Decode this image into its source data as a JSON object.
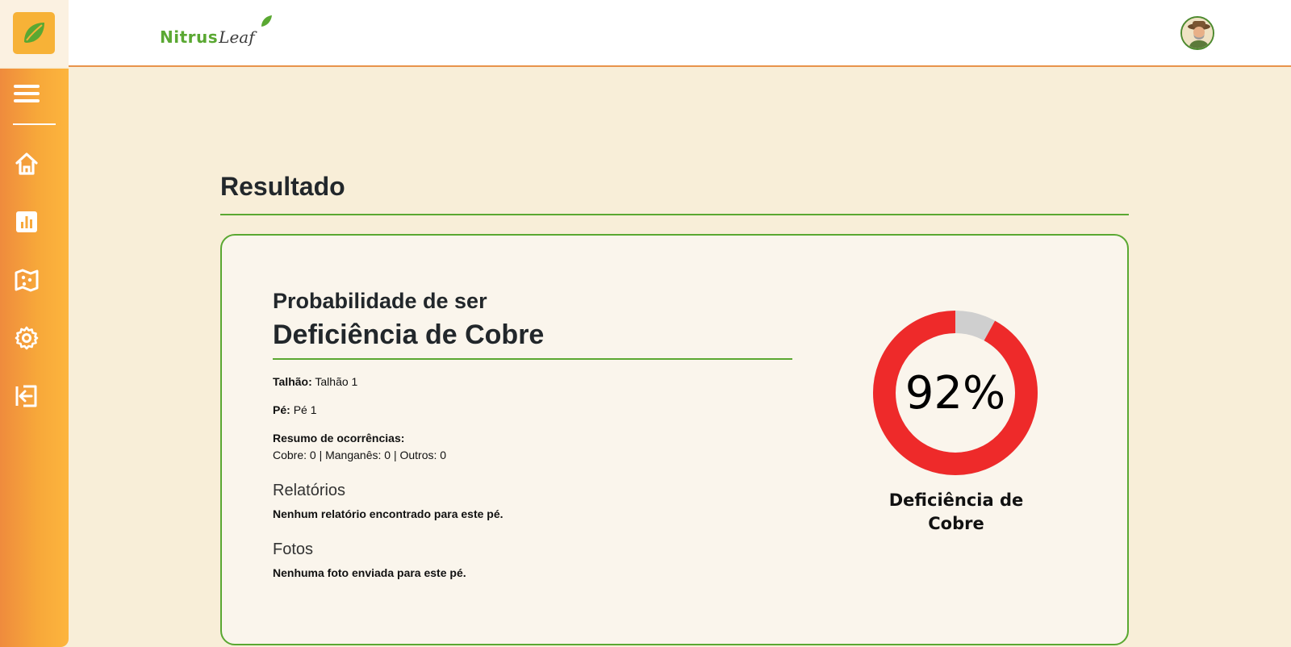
{
  "header": {
    "brand_part1": "Nitrus",
    "brand_part2": "Leaf"
  },
  "sidebar": {
    "items": [
      {
        "icon": "menu-icon"
      },
      {
        "icon": "home-icon"
      },
      {
        "icon": "chart-icon"
      },
      {
        "icon": "map-icon"
      },
      {
        "icon": "gear-icon"
      },
      {
        "icon": "logout-icon"
      }
    ]
  },
  "main": {
    "title": "Resultado",
    "card": {
      "prob_label": "Probabilidade de ser",
      "diagnosis": "Deficiência de Cobre",
      "talhao_label": "Talhão:",
      "talhao_value": "Talhão 1",
      "pe_label": "Pé:",
      "pe_value": "Pé 1",
      "summary_label": "Resumo de ocorrências:",
      "summary_value": "Cobre: 0 | Manganês: 0 | Outros: 0",
      "reports_heading": "Relatórios",
      "reports_text": "Nenhum relatório encontrado para este pé.",
      "photos_heading": "Fotos",
      "photos_text": "Nenhuma foto enviada para este pé."
    },
    "gauge": {
      "value": 92,
      "display": "92%",
      "label_line1": "Deficiência de",
      "label_line2": "Cobre",
      "fill_color": "#ee2a2a",
      "rest_color": "#cfcfcf"
    }
  },
  "colors": {
    "accent_green": "#5aa832",
    "sidebar_orange": "#f7a83a",
    "background": "#f8eed8"
  }
}
